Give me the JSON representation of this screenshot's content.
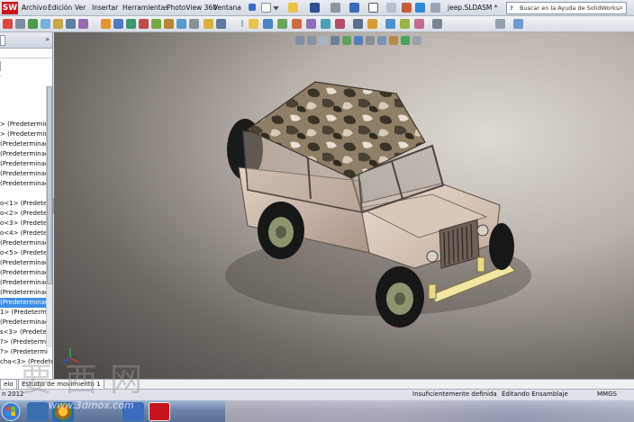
{
  "menubar": {
    "logo": "SW",
    "items": [
      "Archivo",
      "Edición",
      "Ver",
      "Insertar",
      "Herramientas",
      "PhotoView 360",
      "Ventana"
    ],
    "document_title": "jeep.SLDASM *",
    "search_placeholder": "Buscar en la Ayuda de SolidWorks"
  },
  "sidebar": {
    "tree_items": [
      "> (Predeterminad",
      "> (Predeterminad",
      "(Predeterminado",
      "(Predeterminado",
      "(Predeterminado",
      "(Predeterminado",
      "(Predeterminado",
      "o<1> (Predeterm",
      "o<2> (Predeterm",
      "o<3> (Predeterm",
      "o<4> (Predeterm",
      "(Predeterminado",
      "o<5> (Predeterm",
      "(Predeterminado",
      "(Predeterminado",
      "(Predeterminado",
      "(Predeterminado",
      "(Predeterminado",
      "1> (Predetermi",
      "(Predeterminado",
      "s<3> (Predeterm",
      "?> (Predetermi",
      "?> (Predetermi",
      "cha<3> (Predeter"
    ],
    "selected_index": 18
  },
  "bottom_tabs": [
    "elo",
    "Estudio de movimiento 1"
  ],
  "status": {
    "left": "n 2012",
    "definition": "Insuficientemente definida",
    "mode": "Editando Ensamblaje",
    "units": "MMGS"
  },
  "watermark": {
    "chars": "要西网",
    "url": "www.3dmox.com"
  },
  "colors": {
    "viewport_bg": "#b9b2ab",
    "selection": "#3d8ee8",
    "sw_red": "#c8141e",
    "jeep_body": "#cdb6a6",
    "camo_dark": "#3f3a2c",
    "bumper": "#f3e6a2"
  }
}
